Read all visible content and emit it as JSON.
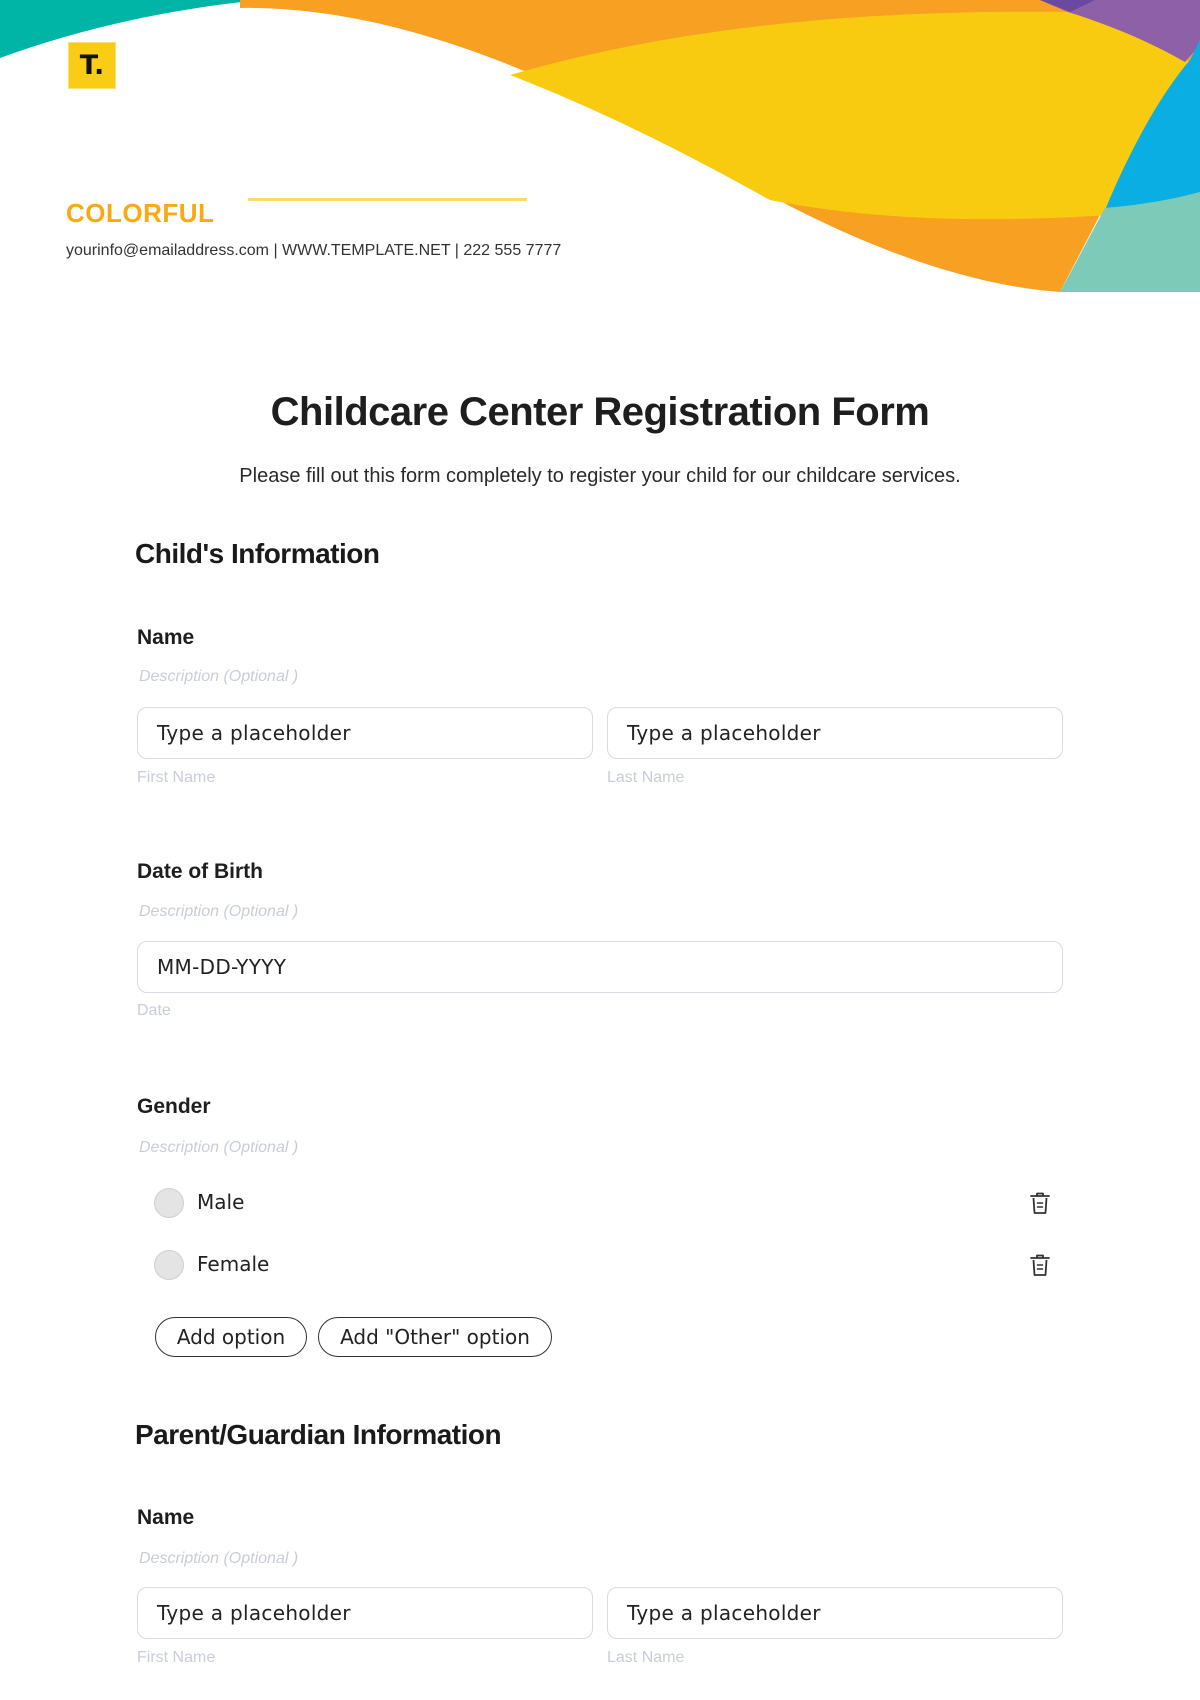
{
  "header": {
    "logo_text": "T.",
    "brand": "COLORFUL",
    "contact": "yourinfo@emailaddress.com | WWW.TEMPLATE.NET | 222 555 7777",
    "colors": {
      "teal": "#00B5A6",
      "orange": "#F8A022",
      "yellow": "#F9CB10",
      "purple": "#8E60A8",
      "deep_purple": "#6A4AA0",
      "blue": "#0AAEE3",
      "mint": "#7DCAB8",
      "brand_text": "#F8AA16",
      "brand_line": "#FFD86A"
    }
  },
  "form": {
    "title": "Childcare Center Registration Form",
    "subtitle": "Please fill out this form completely to register your child for our childcare services.",
    "sections": [
      {
        "title": "Child's Information",
        "fields": [
          {
            "label": "Name",
            "description": "Description  (Optional )",
            "inputs": [
              {
                "placeholder": "Type a placeholder",
                "sublabel": "First Name"
              },
              {
                "placeholder": "Type a placeholder",
                "sublabel": "Last Name"
              }
            ]
          },
          {
            "label": "Date of Birth",
            "description": "Description  (Optional )",
            "inputs": [
              {
                "placeholder": "MM-DD-YYYY",
                "sublabel": "Date"
              }
            ]
          },
          {
            "label": "Gender",
            "description": "Description  (Optional )",
            "options": [
              "Male",
              "Female"
            ],
            "add_option_label": "Add option",
            "add_other_label": "Add \"Other\" option"
          }
        ]
      },
      {
        "title": "Parent/Guardian Information",
        "fields": [
          {
            "label": "Name",
            "description": "Description  (Optional )",
            "inputs": [
              {
                "placeholder": "Type a placeholder",
                "sublabel": "First Name"
              },
              {
                "placeholder": "Type a placeholder",
                "sublabel": "Last Name"
              }
            ]
          }
        ]
      }
    ]
  }
}
